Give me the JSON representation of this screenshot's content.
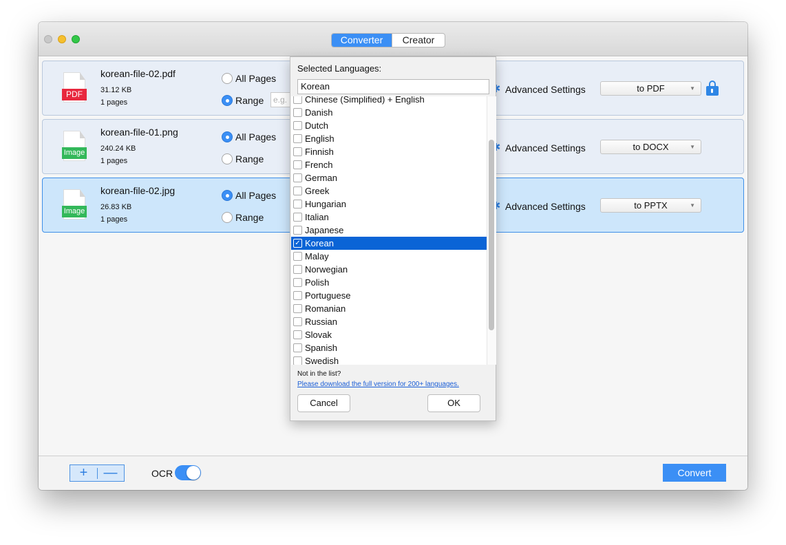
{
  "tabs": [
    "Converter",
    "Creator"
  ],
  "files": [
    {
      "type_tag": "PDF",
      "name": "korean-file-02.pdf",
      "size": "31.12 KB",
      "pages": "1 pages",
      "page_mode": "Range",
      "range_placeholder": "e.g.",
      "format": "to PDF"
    },
    {
      "type_tag": "Image",
      "name": "korean-file-01.png",
      "size": "240.24 KB",
      "pages": "1 pages",
      "page_mode": "All Pages",
      "format": "to DOCX"
    },
    {
      "type_tag": "Image",
      "name": "korean-file-02.jpg",
      "size": "26.83 KB",
      "pages": "1 pages",
      "page_mode": "All Pages",
      "format": "to PPTX"
    }
  ],
  "labels": {
    "all_pages": "All Pages",
    "range": "Range",
    "advanced_settings": "Advanced Settings"
  },
  "footer": {
    "add": "+",
    "remove": "—",
    "ocr": "OCR",
    "ocr_on": true,
    "convert": "Convert"
  },
  "language_popover": {
    "title": "Selected Languages:",
    "selected_value": "Korean",
    "languages": [
      {
        "name": "Chinese (Simplified) + English",
        "checked": false
      },
      {
        "name": "Danish",
        "checked": false
      },
      {
        "name": "Dutch",
        "checked": false
      },
      {
        "name": "English",
        "checked": false
      },
      {
        "name": "Finnish",
        "checked": false
      },
      {
        "name": "French",
        "checked": false
      },
      {
        "name": "German",
        "checked": false
      },
      {
        "name": "Greek",
        "checked": false
      },
      {
        "name": "Hungarian",
        "checked": false
      },
      {
        "name": "Italian",
        "checked": false
      },
      {
        "name": "Japanese",
        "checked": false
      },
      {
        "name": "Korean",
        "checked": true
      },
      {
        "name": "Malay",
        "checked": false
      },
      {
        "name": "Norwegian",
        "checked": false
      },
      {
        "name": "Polish",
        "checked": false
      },
      {
        "name": "Portuguese",
        "checked": false
      },
      {
        "name": "Romanian",
        "checked": false
      },
      {
        "name": "Russian",
        "checked": false
      },
      {
        "name": "Slovak",
        "checked": false
      },
      {
        "name": "Spanish",
        "checked": false
      },
      {
        "name": "Swedish",
        "checked": false
      }
    ],
    "note": "Not in the list?",
    "link": "Please download the full version for 200+ languages.",
    "cancel": "Cancel",
    "ok": "OK"
  },
  "colors": {
    "accent": "#3b8ff5",
    "selected_row": "#cde6fb",
    "pdf_tag": "#e8283e",
    "image_tag": "#33b85a",
    "list_highlight": "#0a64d6"
  },
  "icons": {
    "checkmark": "✓",
    "gear": "✱",
    "dropdown_arrow": "▼"
  }
}
